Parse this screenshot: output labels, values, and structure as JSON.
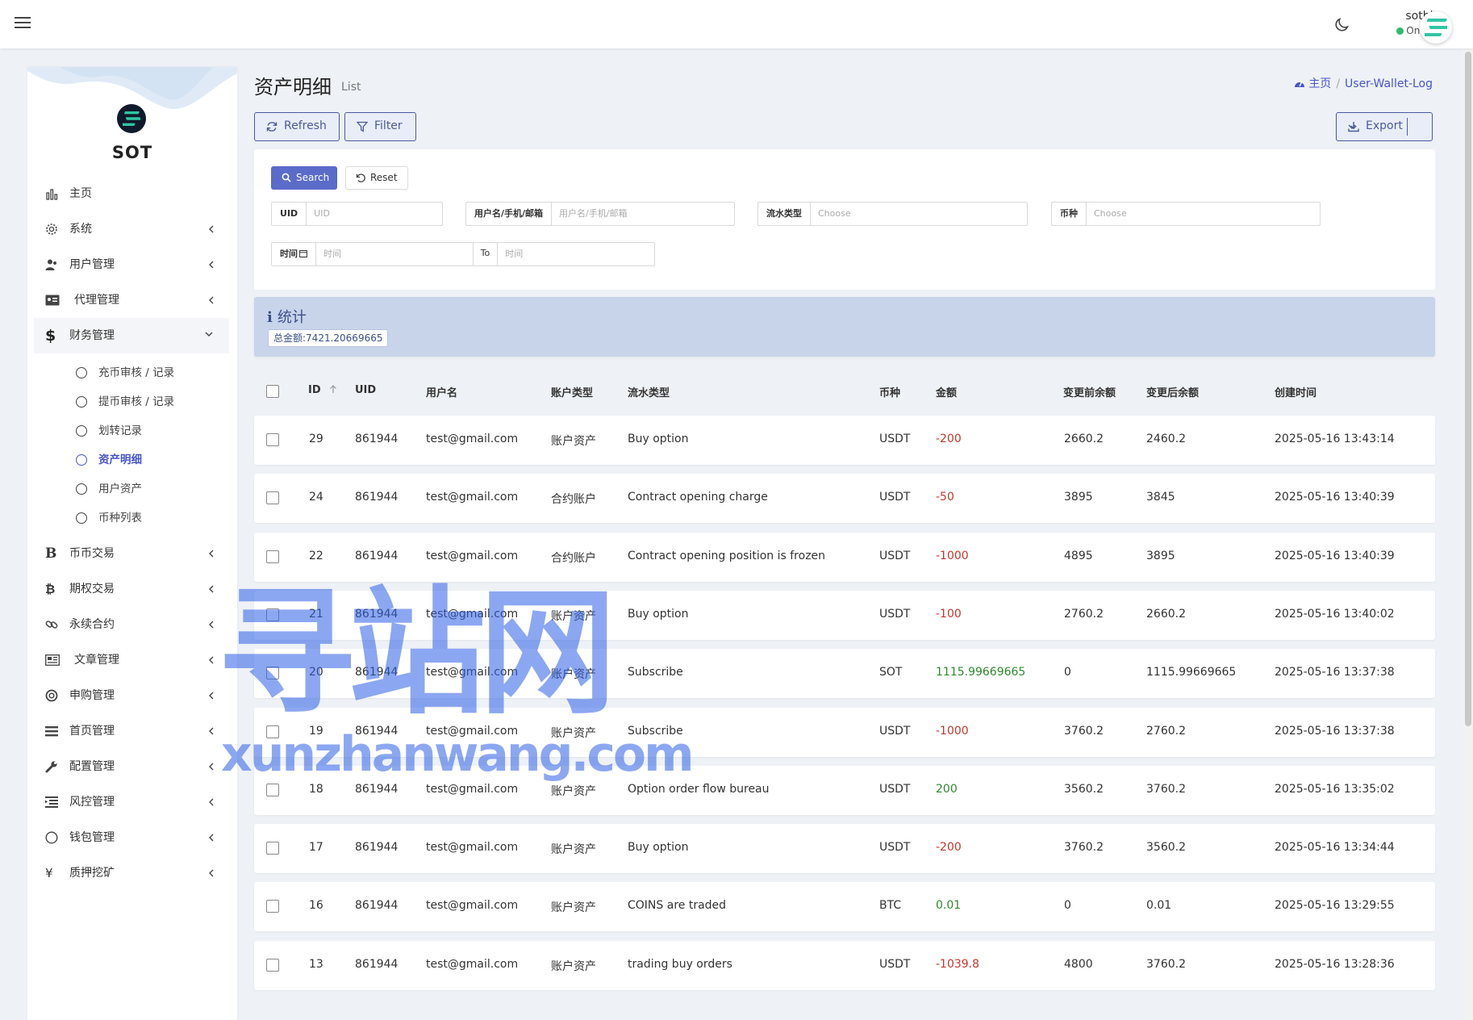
{
  "navbar": {
    "user_name": "sotbit",
    "status": "Online",
    "colors": {
      "status_dot": "#2dbb6a",
      "logo_accent": "#2fc6a4"
    }
  },
  "sidebar": {
    "brand": "SOT",
    "menu": [
      {
        "label": "主页",
        "icon": "bar-chart-icon"
      },
      {
        "label": "系统",
        "icon": "gear-icon"
      },
      {
        "label": "用户管理",
        "icon": "user-group-icon"
      },
      {
        "label": "代理管理",
        "icon": "id-card-icon"
      },
      {
        "label": "财务管理",
        "icon": "dollar-icon"
      },
      {
        "label": "币币交易",
        "icon": "b-letter-icon"
      },
      {
        "label": "期权交易",
        "icon": "bitcoin-icon"
      },
      {
        "label": "永续合约",
        "icon": "link-icon"
      },
      {
        "label": "文章管理",
        "icon": "newspaper-icon"
      },
      {
        "label": "申购管理",
        "icon": "life-ring-icon"
      },
      {
        "label": "首页管理",
        "icon": "list-icon"
      },
      {
        "label": "配置管理",
        "icon": "wrench-icon"
      },
      {
        "label": "风控管理",
        "icon": "indent-icon"
      },
      {
        "label": "钱包管理",
        "icon": "circle-icon"
      },
      {
        "label": "质押挖矿",
        "icon": "yen-icon"
      }
    ],
    "finance_submenu": [
      {
        "label": "充币审核 / 记录"
      },
      {
        "label": "提币审核 / 记录"
      },
      {
        "label": "划转记录"
      },
      {
        "label": "资产明细"
      },
      {
        "label": "用户资产"
      },
      {
        "label": "币种列表"
      }
    ],
    "active_color": "#4755c9"
  },
  "header": {
    "title": "资产明细",
    "subtitle": "List",
    "breadcrumb_home": "主页",
    "breadcrumb_current": "User-Wallet-Log"
  },
  "toolbar": {
    "refresh": "Refresh",
    "filter": "Filter",
    "export": "Export"
  },
  "search": {
    "search_label": "Search",
    "reset_label": "Reset",
    "uid_label": "UID",
    "uid_placeholder": "UID",
    "user_label": "用户名/手机/邮箱",
    "user_placeholder": "用户名/手机/邮箱",
    "type_label": "流水类型",
    "type_placeholder": "Choose",
    "coin_label": "币种",
    "coin_placeholder": "Choose",
    "time_label": "时间",
    "time_from_placeholder": "时间",
    "time_to_label": "To",
    "time_to_placeholder": "时间"
  },
  "stats": {
    "title": "统计",
    "total_label": "总金额:",
    "total_value": "7421.20669665"
  },
  "table": {
    "columns": [
      "ID",
      "UID",
      "用户名",
      "账户类型",
      "流水类型",
      "币种",
      "金额",
      "变更前余额",
      "变更后余额",
      "创建时间"
    ],
    "rows": [
      {
        "id": "29",
        "uid": "861944",
        "username": "test@gmail.com",
        "account": "账户资产",
        "type": "Buy option",
        "coin": "USDT",
        "amount": "-200",
        "sign": "neg",
        "before": "2660.2",
        "after": "2460.2",
        "time": "2025-05-16 13:43:14"
      },
      {
        "id": "24",
        "uid": "861944",
        "username": "test@gmail.com",
        "account": "合约账户",
        "type": "Contract opening charge",
        "coin": "USDT",
        "amount": "-50",
        "sign": "neg",
        "before": "3895",
        "after": "3845",
        "time": "2025-05-16 13:40:39"
      },
      {
        "id": "22",
        "uid": "861944",
        "username": "test@gmail.com",
        "account": "合约账户",
        "type": "Contract opening position is frozen",
        "coin": "USDT",
        "amount": "-1000",
        "sign": "neg",
        "before": "4895",
        "after": "3895",
        "time": "2025-05-16 13:40:39"
      },
      {
        "id": "21",
        "uid": "861944",
        "username": "test@gmail.com",
        "account": "账户资产",
        "type": "Buy option",
        "coin": "USDT",
        "amount": "-100",
        "sign": "neg",
        "before": "2760.2",
        "after": "2660.2",
        "time": "2025-05-16 13:40:02"
      },
      {
        "id": "20",
        "uid": "861944",
        "username": "test@gmail.com",
        "account": "账户资产",
        "type": "Subscribe",
        "coin": "SOT",
        "amount": "1115.99669665",
        "sign": "pos",
        "before": "0",
        "after": "1115.99669665",
        "time": "2025-05-16 13:37:38"
      },
      {
        "id": "19",
        "uid": "861944",
        "username": "test@gmail.com",
        "account": "账户资产",
        "type": "Subscribe",
        "coin": "USDT",
        "amount": "-1000",
        "sign": "neg",
        "before": "3760.2",
        "after": "2760.2",
        "time": "2025-05-16 13:37:38"
      },
      {
        "id": "18",
        "uid": "861944",
        "username": "test@gmail.com",
        "account": "账户资产",
        "type": "Option order flow bureau",
        "coin": "USDT",
        "amount": "200",
        "sign": "pos",
        "before": "3560.2",
        "after": "3760.2",
        "time": "2025-05-16 13:35:02"
      },
      {
        "id": "17",
        "uid": "861944",
        "username": "test@gmail.com",
        "account": "账户资产",
        "type": "Buy option",
        "coin": "USDT",
        "amount": "-200",
        "sign": "neg",
        "before": "3760.2",
        "after": "3560.2",
        "time": "2025-05-16 13:34:44"
      },
      {
        "id": "16",
        "uid": "861944",
        "username": "test@gmail.com",
        "account": "账户资产",
        "type": "COINS are traded",
        "coin": "BTC",
        "amount": "0.01",
        "sign": "pos",
        "before": "0",
        "after": "0.01",
        "time": "2025-05-16 13:29:55"
      },
      {
        "id": "13",
        "uid": "861944",
        "username": "test@gmail.com",
        "account": "账户资产",
        "type": "trading buy orders",
        "coin": "USDT",
        "amount": "-1039.8",
        "sign": "neg",
        "before": "4800",
        "after": "3760.2",
        "time": "2025-05-16 13:28:36"
      }
    ]
  },
  "watermark": {
    "text_cn": "寻站网",
    "text_en": "xunzhanwang.com"
  }
}
